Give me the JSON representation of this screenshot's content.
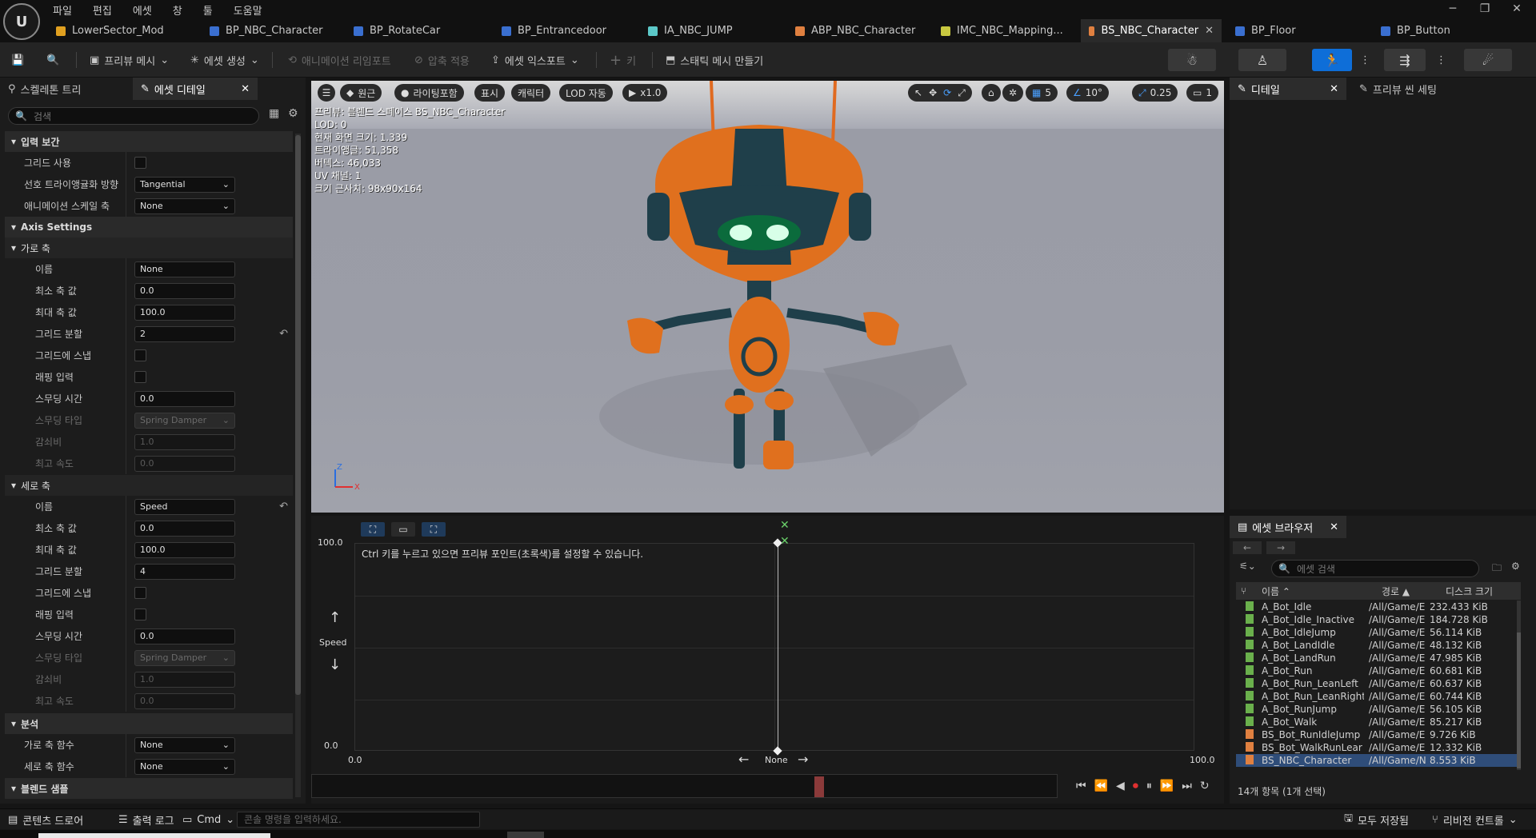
{
  "menu": [
    "파일",
    "편집",
    "에셋",
    "창",
    "툴",
    "도움말"
  ],
  "tabs": [
    {
      "label": "LowerSector_Mod",
      "color": "#e0a020"
    },
    {
      "label": "BP_NBC_Character",
      "color": "#3a6fd0"
    },
    {
      "label": "BP_RotateCar",
      "color": "#3a6fd0"
    },
    {
      "label": "BP_Entrancedoor",
      "color": "#3a6fd0"
    },
    {
      "label": "IA_NBC_JUMP",
      "color": "#5cc8c8"
    },
    {
      "label": "ABP_NBC_Character",
      "color": "#e08040"
    },
    {
      "label": "IMC_NBC_Mapping...",
      "color": "#c8c840"
    },
    {
      "label": "BS_NBC_Character",
      "color": "#e08040"
    },
    {
      "label": "BP_Floor",
      "color": "#3a6fd0"
    },
    {
      "label": "BP_Button",
      "color": "#3a6fd0"
    }
  ],
  "toolbar": {
    "preview_mesh": "프리뷰 메시",
    "create_asset": "에셋 생성",
    "anim_reimport": "애니메이션 리임포트",
    "apply_compression": "압축 적용",
    "export_asset": "에셋 익스포트",
    "key": "키",
    "make_static_mesh": "스태틱 메시 만들기"
  },
  "left_tabs": {
    "skeleton_tree": "스켈레톤 트리",
    "asset_details": "에셋 디테일"
  },
  "search_placeholder": "검색",
  "props": {
    "input_interp": "입력 보간",
    "use_grid": "그리드 사용",
    "pref_tri_dir": "선호 트라이앵귤화 방향",
    "pref_tri_val": "Tangential",
    "anim_scale_axis": "애니메이션 스케일 축",
    "anim_scale_val": "None",
    "axis_settings": "Axis Settings",
    "h_axis": "가로 축",
    "v_axis": "세로 축",
    "name": "이름",
    "min_axis": "최소 축 값",
    "max_axis": "최대 축 값",
    "grid_div": "그리드 분할",
    "snap_grid": "그리드에 스냅",
    "wrap_input": "래핑 입력",
    "smooth_time": "스무딩 시간",
    "smooth_type": "스무딩 타입",
    "damping": "감쇠비",
    "max_speed": "최고 속도",
    "h": {
      "name": "None",
      "min": "0.0",
      "max": "100.0",
      "grid": "2",
      "smooth": "0.0",
      "type": "Spring Damper",
      "damp": "1.0",
      "speed": "0.0"
    },
    "v": {
      "name": "Speed",
      "min": "0.0",
      "max": "100.0",
      "grid": "4",
      "smooth": "0.0",
      "type": "Spring Damper",
      "damp": "1.0",
      "speed": "0.0"
    },
    "analysis": "분석",
    "h_func": "가로 축 함수",
    "h_func_val": "None",
    "v_func": "세로 축 함수",
    "v_func_val": "None",
    "blend_samples": "블렌드 샘플"
  },
  "viewport": {
    "buttons": [
      "원근",
      "라이팅포함",
      "표시",
      "캐릭터",
      "LOD 자동",
      "x1.0"
    ],
    "nums": [
      "5",
      "10°",
      "0.25",
      "1"
    ],
    "info": [
      "프리뷰: 블렌드 스페이스 BS_NBC_Character",
      "LOD: 0",
      "현재 화면 크기: 1.339",
      "트라이앵글: 51,358",
      "버텍스: 46,033",
      "UV 채널: 1",
      "크기 근사치: 98x90x164"
    ]
  },
  "blendspace": {
    "hint": "Ctrl 키를 누르고 있으면 프리뷰 포인트(초록색)를 설정할 수 있습니다.",
    "y_max": "100.0",
    "y_min": "0.0",
    "y_label": "Speed",
    "x_min": "0.0",
    "x_max": "100.0",
    "x_label": "None"
  },
  "right_tabs": {
    "details": "디테일",
    "preview_scene": "프리뷰 씬 세팅"
  },
  "asset_browser": {
    "title": "에셋 브라우저",
    "search": "에셋 검색",
    "cols": [
      "이름",
      "경로",
      "디스크 크기"
    ],
    "rows": [
      {
        "name": "A_Bot_Idle",
        "path": "/All/Game/E",
        "size": "232.433 KiB"
      },
      {
        "name": "A_Bot_Idle_Inactive",
        "path": "/All/Game/E",
        "size": "184.728 KiB"
      },
      {
        "name": "A_Bot_IdleJump",
        "path": "/All/Game/E",
        "size": "56.114 KiB"
      },
      {
        "name": "A_Bot_LandIdle",
        "path": "/All/Game/E",
        "size": "48.132 KiB"
      },
      {
        "name": "A_Bot_LandRun",
        "path": "/All/Game/E",
        "size": "47.985 KiB"
      },
      {
        "name": "A_Bot_Run",
        "path": "/All/Game/E",
        "size": "60.681 KiB"
      },
      {
        "name": "A_Bot_Run_LeanLeft",
        "path": "/All/Game/E",
        "size": "60.637 KiB"
      },
      {
        "name": "A_Bot_Run_LeanRight",
        "path": "/All/Game/E",
        "size": "60.744 KiB"
      },
      {
        "name": "A_Bot_RunJump",
        "path": "/All/Game/E",
        "size": "56.105 KiB"
      },
      {
        "name": "A_Bot_Walk",
        "path": "/All/Game/E",
        "size": "85.217 KiB"
      },
      {
        "name": "BS_Bot_RunIdleJump",
        "path": "/All/Game/E",
        "size": "9.726 KiB"
      },
      {
        "name": "BS_Bot_WalkRunLear",
        "path": "/All/Game/E",
        "size": "12.332 KiB"
      },
      {
        "name": "BS_NBC_Character",
        "path": "/All/Game/N",
        "size": "8.553 KiB"
      }
    ],
    "count": "14개 항목 (1개 선택)"
  },
  "status": {
    "drawer": "콘텐츠 드로어",
    "log": "출력 로그",
    "cmd": "Cmd",
    "console": "콘솔 명령을 입력하세요.",
    "save_all": "모두 저장됨",
    "revision": "리비전 컨트롤"
  }
}
